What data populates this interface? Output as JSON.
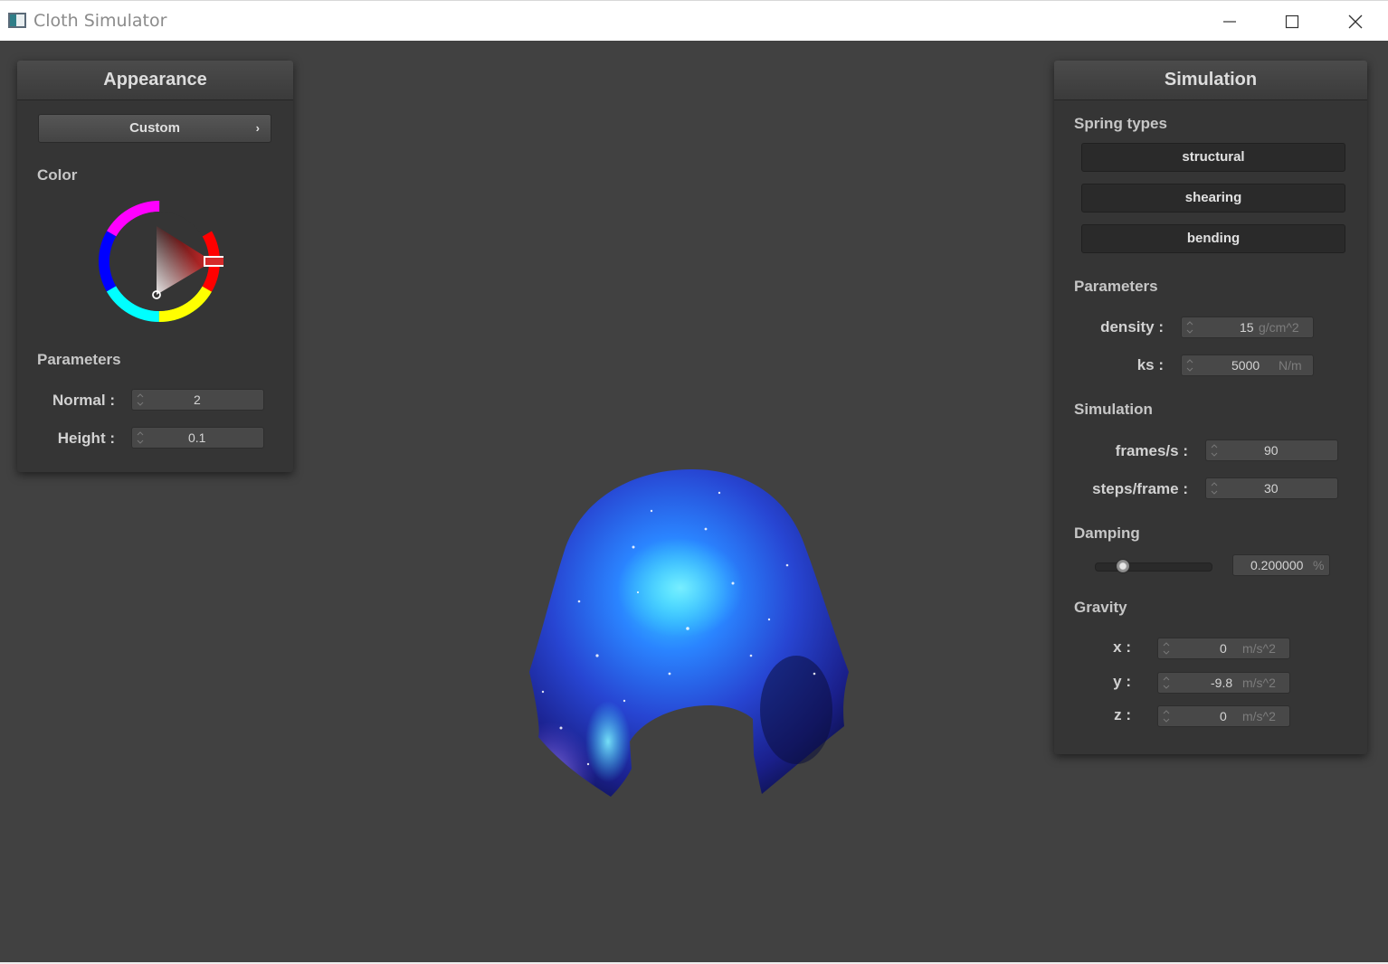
{
  "window": {
    "title": "Cloth Simulator"
  },
  "appearance": {
    "title": "Appearance",
    "preset_label": "Custom",
    "color_label": "Color",
    "parameters_label": "Parameters",
    "normal_label": "Normal :",
    "normal_value": "2",
    "height_label": "Height :",
    "height_value": "0.1",
    "selected_color": "#d42a2a"
  },
  "simulation": {
    "title": "Simulation",
    "spring_types_label": "Spring types",
    "spring_buttons": [
      "structural",
      "shearing",
      "bending"
    ],
    "parameters_label": "Parameters",
    "density": {
      "label": "density :",
      "value": "15",
      "unit": "g/cm^2"
    },
    "ks": {
      "label": "ks :",
      "value": "5000",
      "unit": "N/m"
    },
    "section_label": "Simulation",
    "fps": {
      "label": "frames/s :",
      "value": "90"
    },
    "steps": {
      "label": "steps/frame :",
      "value": "30"
    },
    "damping_label": "Damping",
    "damping": {
      "value": "0.200000",
      "unit": "%",
      "slider_fraction": 0.2
    },
    "gravity_label": "Gravity",
    "gravity": {
      "x": {
        "label": "x :",
        "value": "0",
        "unit": "m/s^2"
      },
      "y": {
        "label": "y :",
        "value": "-9.8",
        "unit": "m/s^2"
      },
      "z": {
        "label": "z :",
        "value": "0",
        "unit": "m/s^2"
      }
    }
  },
  "colors": {
    "background": "#414141",
    "panel": "#353535",
    "cloth": "#2a49d6",
    "accent_red": "#d42a2a"
  },
  "icons": [
    "app-icon",
    "minimize-icon",
    "maximize-icon",
    "close-icon",
    "chevron-right-icon",
    "spin-arrows-icon"
  ]
}
